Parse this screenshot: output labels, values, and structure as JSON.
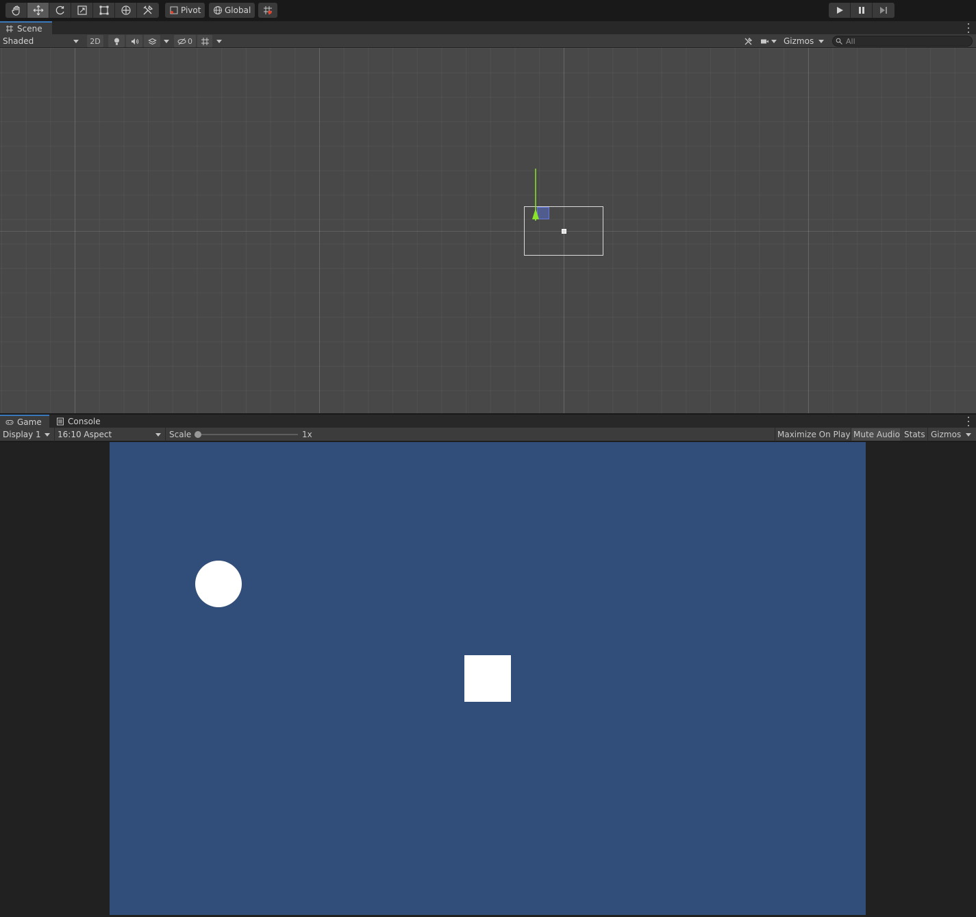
{
  "toolbar": {
    "tools": [
      {
        "icon": "hand-tool-icon"
      },
      {
        "icon": "move-tool-icon"
      },
      {
        "icon": "rotate-tool-icon"
      },
      {
        "icon": "scale-tool-icon"
      },
      {
        "icon": "rect-tool-icon"
      },
      {
        "icon": "transform-tool-icon"
      },
      {
        "icon": "custom-tool-icon"
      }
    ],
    "pivot_label": "Pivot",
    "global_label": "Global",
    "snap_icon": "grid-snap-icon",
    "play_icons": [
      "play-icon",
      "pause-icon",
      "step-icon"
    ]
  },
  "scene": {
    "tab_label": "Scene",
    "draw_mode": "Shaded",
    "mode_2d": "2D",
    "hidden_count": "0",
    "gizmos_label": "Gizmos",
    "search_placeholder": "All",
    "gizmo_colors": {
      "x_axis": "#e8402a",
      "y_axis": "#8be22b",
      "plane": "#5a6ec8"
    }
  },
  "game": {
    "tab_label": "Game",
    "console_tab_label": "Console",
    "display": "Display 1",
    "aspect": "16:10 Aspect",
    "scale_label": "Scale",
    "scale_value": "1x",
    "maximize_label": "Maximize On Play",
    "mute_label": "Mute Audio",
    "stats_label": "Stats",
    "gizmos_label": "Gizmos",
    "background_color": "#314d79",
    "sprite_color": "#ffffff"
  }
}
